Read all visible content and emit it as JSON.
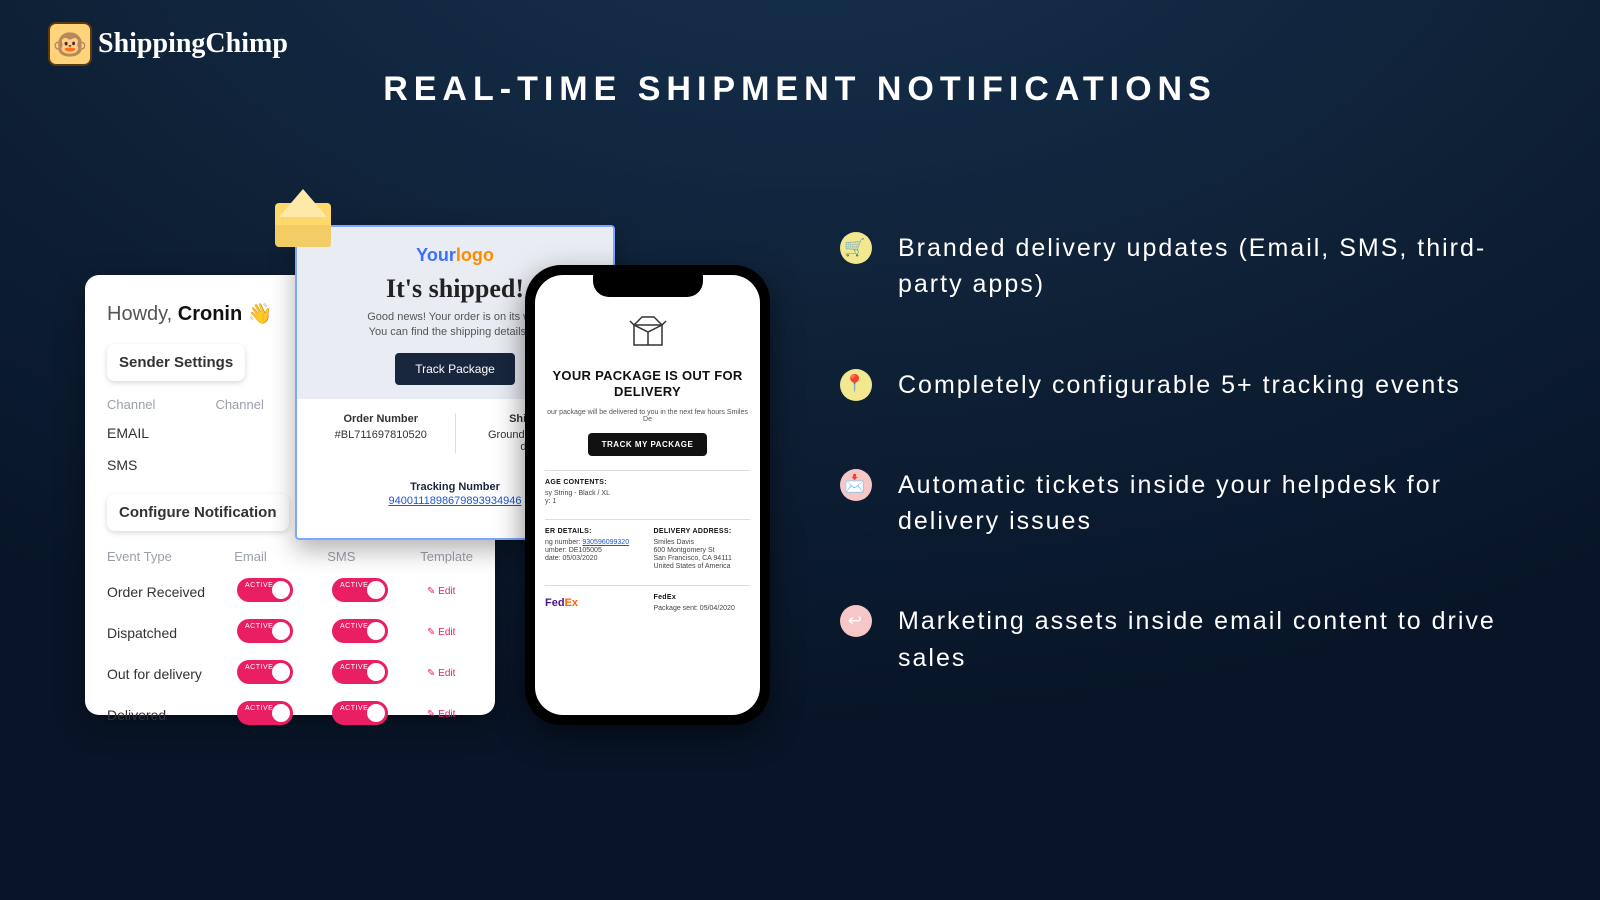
{
  "logo": {
    "text": "ShippingChimp"
  },
  "headline": "REAL-TIME SHIPMENT NOTIFICATIONS",
  "features": [
    {
      "icon": "🛒",
      "text": "Branded delivery updates (Email, SMS, third-party apps)"
    },
    {
      "icon": "📍",
      "text": "Completely configurable 5+ tracking events"
    },
    {
      "icon": "📩",
      "text": "Automatic tickets inside your helpdesk for delivery issues"
    },
    {
      "icon": "↩",
      "text": "Marketing assets inside email content to drive sales"
    }
  ],
  "settings": {
    "greeting_prefix": "Howdy, ",
    "greeting_name": "Cronin",
    "greeting_emoji": "👋",
    "sender_tab": "Sender Settings",
    "col1": "Channel",
    "col2": "Channel",
    "channels": [
      "EMAIL",
      "SMS"
    ],
    "configure_tab": "Configure Notification",
    "cfg_cols": [
      "Event Type",
      "Email",
      "SMS",
      "Template"
    ],
    "events": [
      "Order Received",
      "Dispatched",
      "Out for delivery",
      "Delivered"
    ],
    "toggle_word": "ACTIVE",
    "edit_label": "Edit"
  },
  "email": {
    "brand_a": "Your",
    "brand_b": "logo",
    "title": "It's shipped!",
    "sub1": "Good news! Your order is on its way",
    "sub2": "You can find the shipping details be",
    "cta": "Track Package",
    "order_k": "Order Number",
    "order_v": "#BL711697810520",
    "ship_k": "Shippin",
    "ship_v1": "Ground Shipping",
    "ship_v2": "day",
    "track_k": "Tracking Number",
    "track_v": "9400111898679893934946"
  },
  "phone": {
    "title": "YOUR PACKAGE IS OUT FOR DELIVERY",
    "sub": "our package will be delivered to you in the next few hours Smiles De",
    "cta": "TRACK MY PACKAGE",
    "contents_hd": "AGE CONTENTS:",
    "contents_line": "sy String - Black / XL",
    "contents_qty": "y: 1",
    "details_hd": "ER DETAILS:",
    "d1k": "ng number:",
    "d1v": "930596099320",
    "d2k": "umber:",
    "d2v": "DE105005",
    "d3k": "date:",
    "d3v": "05/03/2020",
    "addr_hd": "DELIVERY ADDRESS:",
    "a1": "Smiles Davis",
    "a2": "600 Montgomery St",
    "a3": "San Francisco, CA 94111",
    "a4": "United States of America",
    "carrier_hd": "FedEx",
    "carrier_line": "Package sent: 05/04/2020"
  }
}
